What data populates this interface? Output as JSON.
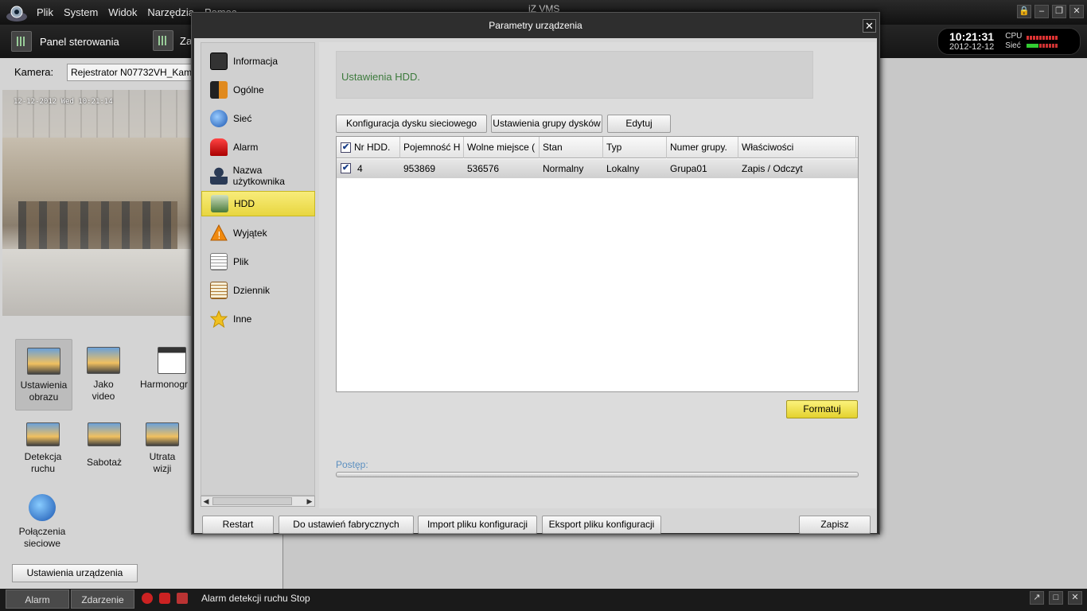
{
  "app": {
    "title": "iZ VMS",
    "menu": [
      "Plik",
      "System",
      "Widok",
      "Narzędzia",
      "Pomoc"
    ],
    "window_buttons": [
      "lock-icon",
      "minimize-icon",
      "restore-icon",
      "close-icon"
    ]
  },
  "toolbar": {
    "tab1_label": "Panel sterowania",
    "tab2_label": "Zar",
    "clock_time": "10:21:31",
    "clock_date": "2012-12-12",
    "cpu_label": "CPU",
    "net_label": "Sieć"
  },
  "left": {
    "camera_label": "Kamera:",
    "camera_value": "Rejestrator N07732VH_Kam",
    "osd": "12-12-2012 Wed 10:21:14",
    "tiles": [
      {
        "label1": "Ustawienia",
        "label2": "obrazu",
        "icon": "image-settings-icon"
      },
      {
        "label1": "Jako",
        "label2": "video",
        "icon": "video-quality-icon"
      },
      {
        "label1": "Harmonogr",
        "label2": "",
        "icon": "calendar-icon"
      },
      {
        "label1": "Detekcja",
        "label2": "ruchu",
        "icon": "motion-detection-icon"
      },
      {
        "label1": "Sabotaż",
        "label2": "",
        "icon": "tamper-hand-icon"
      },
      {
        "label1": "Utrata",
        "label2": "wizji",
        "icon": "video-loss-icon"
      },
      {
        "label1": "Połączenia",
        "label2": "sieciowe",
        "icon": "network-globe-icon"
      }
    ],
    "device_settings_btn": "Ustawienia urządzenia"
  },
  "status": {
    "tab_alarm": "Alarm",
    "tab_events": "Zdarzenie",
    "message": "Alarm detekcji ruchu Stop"
  },
  "dialog": {
    "title": "Parametry urządzenia",
    "nav": [
      {
        "label": "Informacja",
        "icon": "info-icon",
        "color": "#333333"
      },
      {
        "label": "Ogólne",
        "icon": "general-icon",
        "color": "#e08a1e"
      },
      {
        "label": "Sieć",
        "icon": "network-icon",
        "color": "#2a6ad0"
      },
      {
        "label": "Alarm",
        "icon": "alarm-siren-icon",
        "color": "#d02020"
      },
      {
        "label": "Nazwa użytkownika",
        "icon": "user-icon",
        "color": "#2a3a55"
      },
      {
        "label": "HDD",
        "icon": "hdd-icon",
        "color": "#4a7a3a"
      },
      {
        "label": "Wyjątek",
        "icon": "warning-icon",
        "color": "#f08a10"
      },
      {
        "label": "Plik",
        "icon": "file-icon",
        "color": "#888888"
      },
      {
        "label": "Dziennik",
        "icon": "log-icon",
        "color": "#b07a30"
      },
      {
        "label": "Inne",
        "icon": "star-icon",
        "color": "#f0c020"
      }
    ],
    "selected_nav": "HDD",
    "header_text": "Ustawienia HDD.",
    "buttons": {
      "network_disk": "Konfiguracja dysku sieciowego",
      "disk_groups": "Ustawienia grupy dysków",
      "edit": "Edytuj",
      "format": "Formatuj",
      "restart": "Restart",
      "factory": "Do ustawień fabrycznych",
      "import": "Import pliku konfiguracji",
      "export": "Eksport pliku konfiguracji",
      "save": "Zapisz"
    },
    "table": {
      "columns": [
        "Nr HDD.",
        "Pojemność H",
        "Wolne miejsce (",
        "Stan",
        "Typ",
        "Numer grupy.",
        "Właściwości"
      ],
      "rows": [
        {
          "checked": true,
          "nr": "4",
          "capacity": "953869",
          "free": "536576",
          "state": "Normalny",
          "type": "Lokalny",
          "group": "Grupa01",
          "props": "Zapis / Odczyt"
        }
      ]
    },
    "progress_label": "Postęp:",
    "progress": 0
  }
}
